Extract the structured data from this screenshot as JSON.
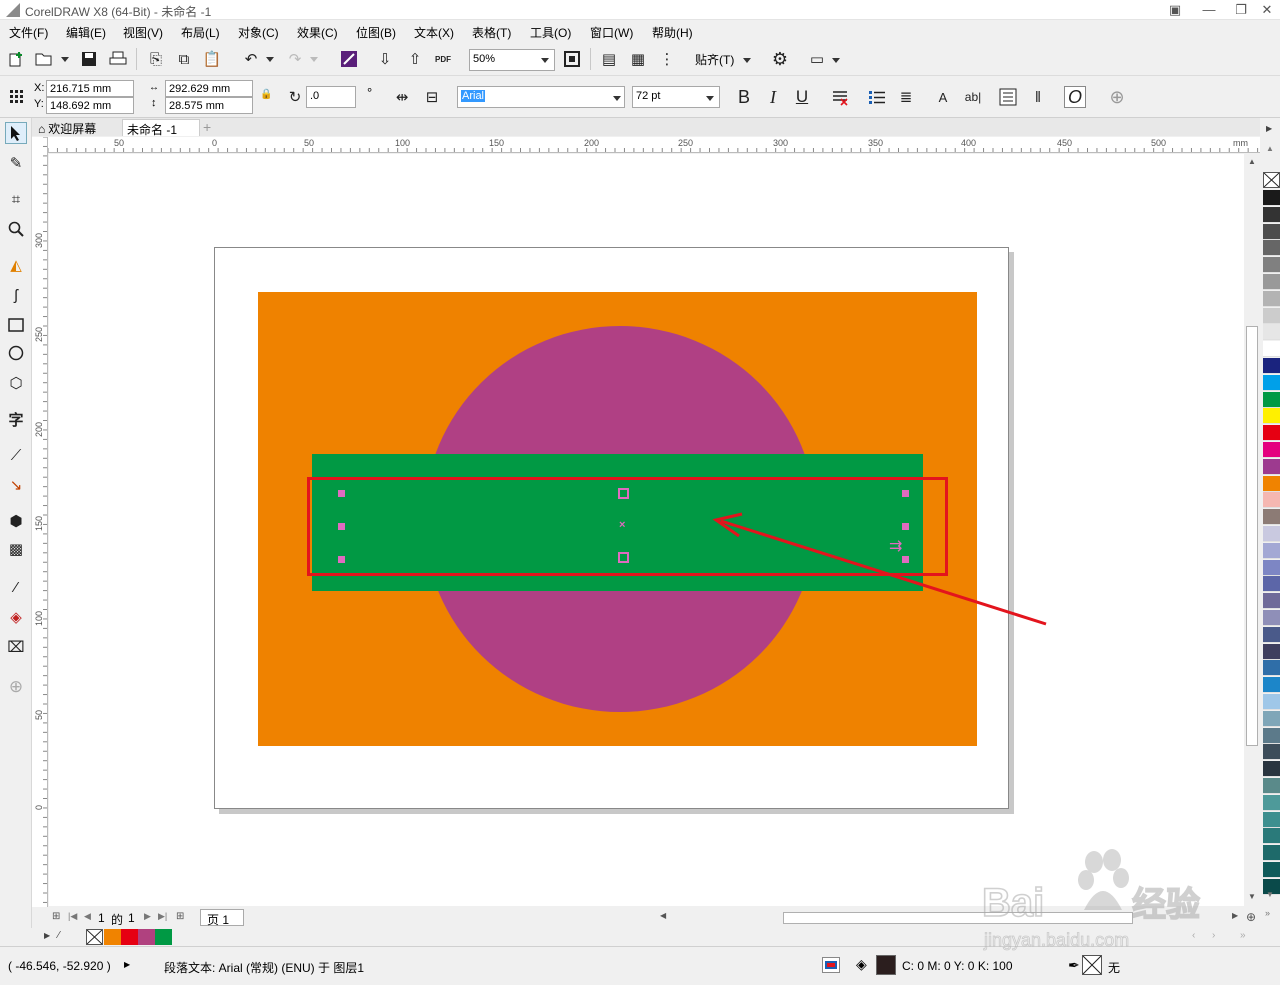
{
  "window": {
    "title": "CorelDRAW X8 (64-Bit) - 未命名 -1"
  },
  "menu": [
    "文件(F)",
    "编辑(E)",
    "视图(V)",
    "布局(L)",
    "对象(C)",
    "效果(C)",
    "位图(B)",
    "文本(X)",
    "表格(T)",
    "工具(O)",
    "窗口(W)",
    "帮助(H)"
  ],
  "toolbar": {
    "zoom": "50%",
    "snap_label": "贴齐(T)",
    "pdf_label": "PDF"
  },
  "props": {
    "x_label": "X:",
    "x": "216.715 mm",
    "y_label": "Y:",
    "y": "148.692 mm",
    "w": "292.629 mm",
    "h": "28.575 mm",
    "rotation": ".0",
    "degree": "°",
    "font": "Arial",
    "size": "72 pt",
    "bold": "B",
    "italic": "I",
    "underline": "U",
    "char_icon": "A",
    "abl_icon": "ab|",
    "oblique_icon": "O"
  },
  "tabs": {
    "welcome": "欢迎屏幕",
    "doc": "未命名 -1"
  },
  "ruler": {
    "h_labels": [
      "50",
      "0",
      "50",
      "100",
      "150",
      "200",
      "250",
      "300",
      "350",
      "400",
      "450",
      "500",
      "mm"
    ],
    "v_labels": [
      "300",
      "250",
      "200",
      "150",
      "100",
      "50",
      "0"
    ]
  },
  "pagenav": {
    "current": "1",
    "of": "的",
    "total": "1",
    "page_tab": "页 1"
  },
  "palette": [
    "#1a1a1a",
    "#333333",
    "#4d4d4d",
    "#666666",
    "#808080",
    "#999999",
    "#b3b3b3",
    "#cccccc",
    "#e6e6e6",
    "#ffffff",
    "#1a237e",
    "#00a0e9",
    "#009944",
    "#fff000",
    "#e60012",
    "#e4007f",
    "#9d3a8f",
    "#f08300",
    "#f5b7b1",
    "#8c7b75",
    "#c9c9e0",
    "#a3a8d4",
    "#7d86c4",
    "#5c66a8",
    "#6f6a99",
    "#8f8fb8",
    "#4a5a8a",
    "#3e3e5e",
    "#2f6ea8",
    "#1c86c9",
    "#9fc7e8",
    "#7fa6b8",
    "#5c7a8a",
    "#3d4d5a",
    "#2a3540",
    "#5a8a8a",
    "#4e9a9a",
    "#3d8f8f",
    "#2a7a7a",
    "#1e6a6a",
    "#0f5a5a",
    "#0a4a4a"
  ],
  "doc_palette": [
    "#f08300",
    "#e60012",
    "#b0417f",
    "#009944"
  ],
  "status": {
    "coords": "( -46.546, -52.920 )",
    "object_info": "段落文本: Arial (常规) (ENU) 于 图层1",
    "fill_info": "C: 0 M: 0 Y: 0 K: 100",
    "outline_none": "无"
  },
  "colors": {
    "orange": "#ef8200",
    "purple": "#b04084",
    "green": "#019944",
    "red": "#e3141d",
    "handle": "#e06bc0"
  },
  "watermark": {
    "text": "Bai 经验",
    "url": "jingyan.baidu.com"
  }
}
